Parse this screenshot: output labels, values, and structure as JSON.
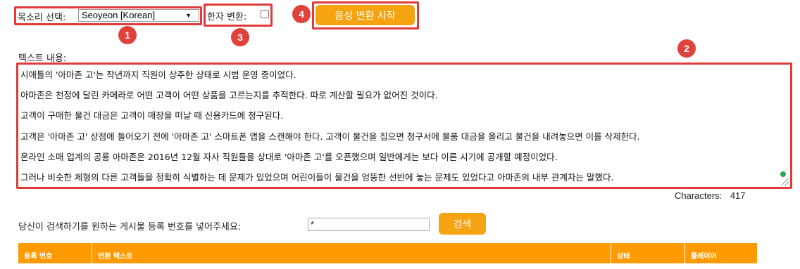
{
  "voice": {
    "label": "목소리 선택:",
    "selected": "Seoyeon [Korean]"
  },
  "hanja": {
    "label": "한자 변환:"
  },
  "start_button": "음성 변환 시작",
  "badges": [
    "1",
    "2",
    "3",
    "4"
  ],
  "text_area": {
    "label": "텍스트 내용:",
    "lines": [
      "시애틀의 '아마존 고'는 작년까지 직원이 상주한 상태로 시범 운영 중이었다.",
      "아마존은 천정에 달린 카메라로 어떤 고객이 어떤 상품을 고르는지를 추적한다. 따로 계산할 필요가 없어진 것이다.",
      "고객이 구매한 물건 대금은 고객이 매장을 떠날 때 신용카드에 청구된다.",
      "고객은 '아마존 고' 상점에 들어오기 전에 '아마존 고' 스마트폰 앱을 스캔해야 한다. 고객이 물건을 집으면 청구서에 물품 대금을 올리고 물건을 내려놓으면 이를 삭제한다.",
      "온라인 소매 업계의 공룡 아마존은 2016년 12월 자사 직원들을 상대로 '아마존 고'를 오픈했으며 일반에게는 보다 이른 시기에 공개할 예정이었다.",
      "그러나 비슷한 체형의 다른 고객들을 정확히 식별하는 데 문제가 있었으며 어린이들이 물건을 엉뚱한 선반에 놓는 문제도 있었다고 아마존의 내부 관계자는 말했다."
    ]
  },
  "characters": {
    "label": "Characters:",
    "count": "417"
  },
  "search": {
    "label": "당신이 검색하기를 원하는 게시물 등록 번호를 넣어주세요:",
    "value": "*",
    "button": "검색"
  },
  "table": {
    "headers": [
      "등록 번호",
      "변환 텍스트",
      "상태",
      "플레이어"
    ]
  },
  "colors": {
    "accent": "#f5a311",
    "annotation": "#e03a3a",
    "table_header": "#ff9a00"
  }
}
